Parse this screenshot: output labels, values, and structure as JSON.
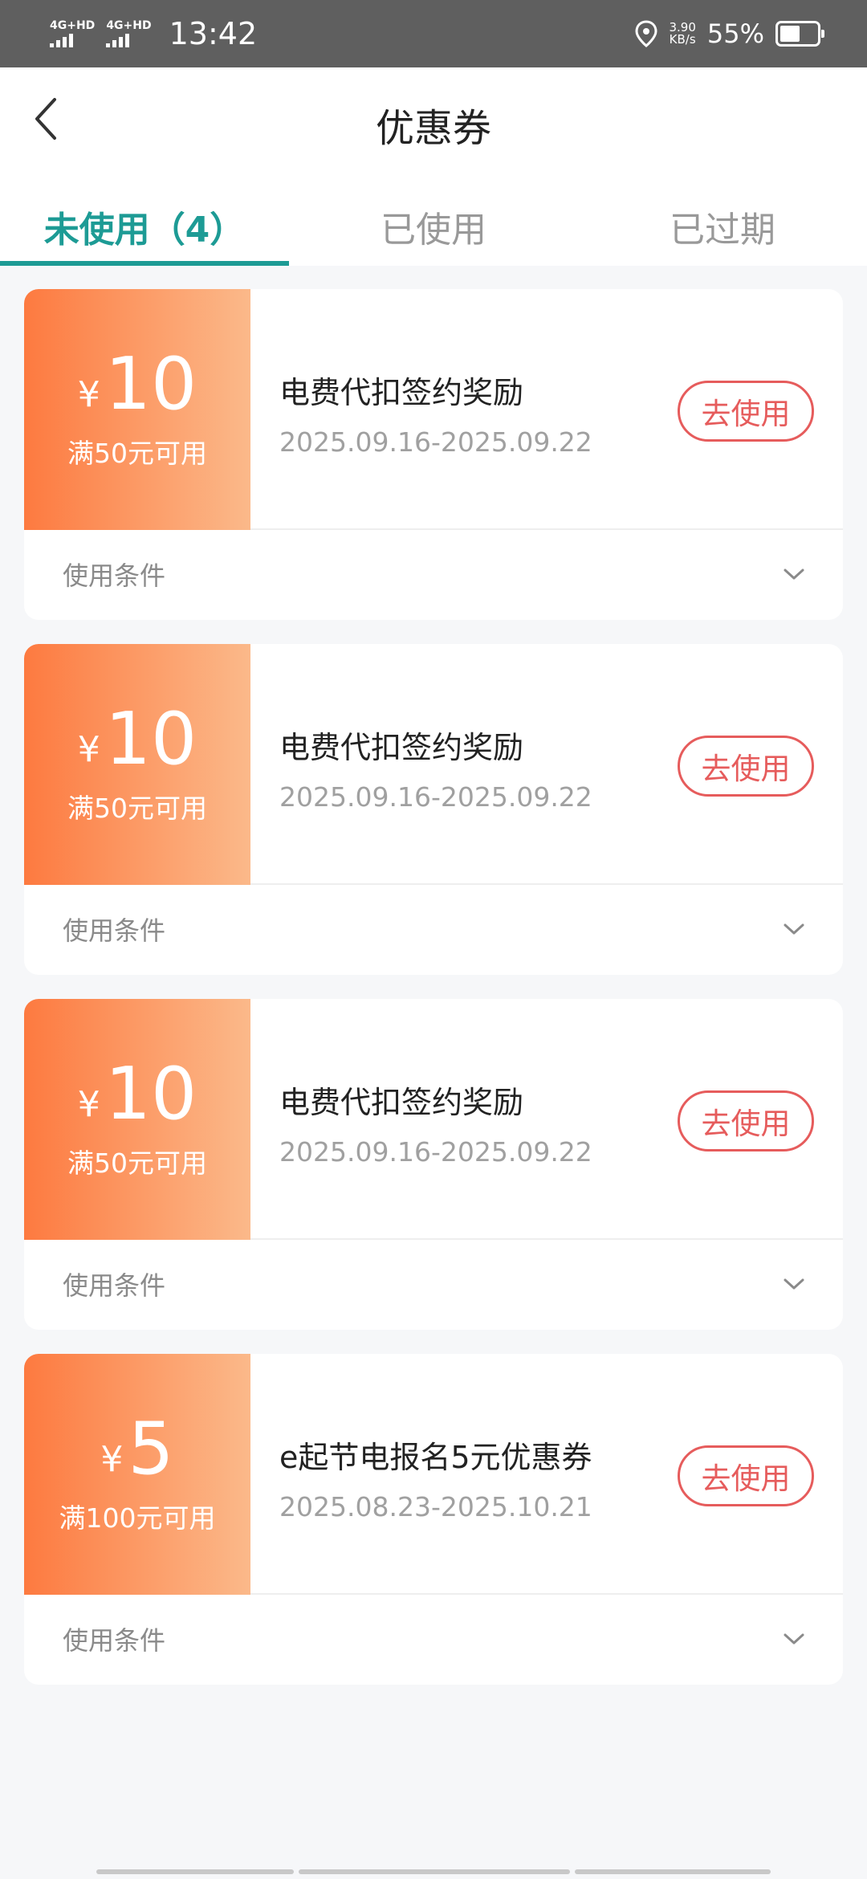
{
  "status_bar": {
    "sim1_label": "4G+HD",
    "sim2_label": "4G+HD",
    "time": "13:42",
    "net_speed_value": "3.90",
    "net_speed_unit": "KB/s",
    "battery_percent": "55%",
    "battery_level": 0.55
  },
  "header": {
    "title": "优惠券"
  },
  "tabs": [
    {
      "label": "未使用（4）",
      "active": true
    },
    {
      "label": "已使用",
      "active": false
    },
    {
      "label": "已过期",
      "active": false
    }
  ],
  "coupons": [
    {
      "currency": "¥",
      "amount": "10",
      "threshold": "满50元可用",
      "name": "电费代扣签约奖励",
      "date_range": "2025.09.16-2025.09.22",
      "action": "去使用",
      "conditions_label": "使用条件"
    },
    {
      "currency": "¥",
      "amount": "10",
      "threshold": "满50元可用",
      "name": "电费代扣签约奖励",
      "date_range": "2025.09.16-2025.09.22",
      "action": "去使用",
      "conditions_label": "使用条件"
    },
    {
      "currency": "¥",
      "amount": "10",
      "threshold": "满50元可用",
      "name": "电费代扣签约奖励",
      "date_range": "2025.09.16-2025.09.22",
      "action": "去使用",
      "conditions_label": "使用条件"
    },
    {
      "currency": "¥",
      "amount": "5",
      "threshold": "满100元可用",
      "name": "e起节电报名5元优惠券",
      "date_range": "2025.08.23-2025.10.21",
      "action": "去使用",
      "conditions_label": "使用条件"
    }
  ],
  "colors": {
    "accent": "#1d9b95",
    "coupon_gradient_start": "#fd7a40",
    "coupon_gradient_end": "#fbb98a",
    "action_red": "#e65c5c"
  }
}
